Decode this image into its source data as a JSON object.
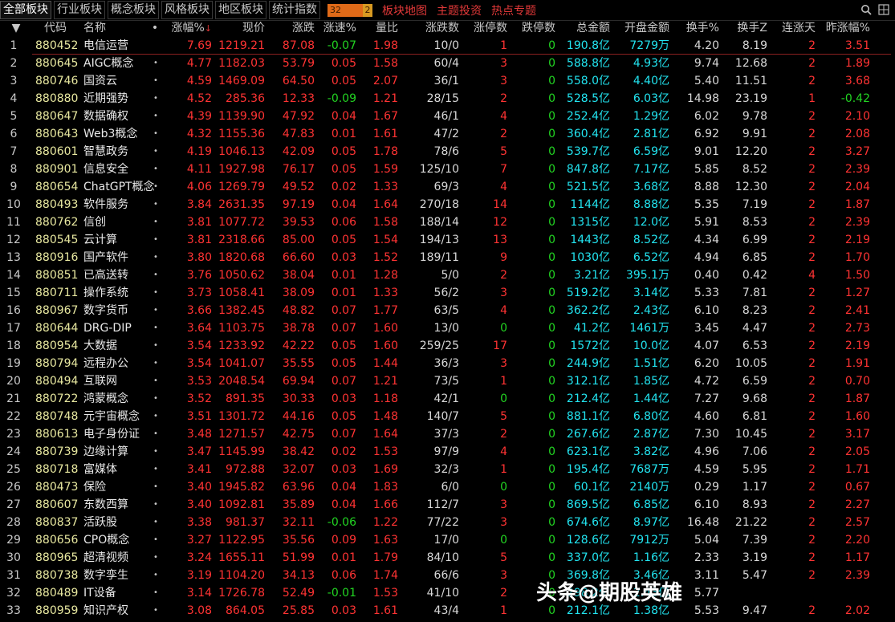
{
  "tabs": [
    {
      "label": "全部板块",
      "active": true
    },
    {
      "label": "行业板块"
    },
    {
      "label": "概念板块"
    },
    {
      "label": "风格板块"
    },
    {
      "label": "地区板块"
    },
    {
      "label": "统计指数"
    }
  ],
  "counter": {
    "value": "32",
    "flag": "2"
  },
  "links": [
    "板块地图",
    "主题投资",
    "热点专题"
  ],
  "icons": [
    "search-icon",
    "grid-icon"
  ],
  "colors": {
    "up": "#ff3333",
    "down": "#22d422",
    "cyan": "#22e4f0",
    "code": "#e8e8a0",
    "accent": "#e03838"
  },
  "columns": {
    "sort": "▼",
    "code": "代码",
    "name": "名称",
    "dot": "•",
    "change_pct": "涨幅%",
    "sort_icon": "↓",
    "price": "现价",
    "change": "涨跌",
    "speed": "涨速%",
    "volume_ratio": "量比",
    "up_down": "涨跌数",
    "limit_up": "涨停数",
    "limit_down": "跌停数",
    "amount": "总金额",
    "open_amount": "开盘金额",
    "turnover": "换手%",
    "turnover_z": "换手Z",
    "consecutive": "连涨天",
    "prev_change": "昨涨幅%"
  },
  "rows": [
    {
      "idx": "1",
      "code": "880452",
      "name": "电信运营",
      "dot": "",
      "pct": "7.69",
      "price": "1219.21",
      "chg": "87.08",
      "spd": "-0.07",
      "vr": "1.98",
      "ud": "10/0",
      "lu": "1",
      "ld": "0",
      "amt": "190.8亿",
      "oamt": "7279万",
      "to": "4.20",
      "toz": "8.19",
      "cd": "2",
      "prev": "3.51"
    },
    {
      "idx": "2",
      "code": "880645",
      "name": "AIGC概念",
      "dot": "•",
      "pct": "4.77",
      "price": "1182.03",
      "chg": "53.79",
      "spd": "0.05",
      "vr": "1.58",
      "ud": "60/4",
      "lu": "3",
      "ld": "0",
      "amt": "588.8亿",
      "oamt": "4.93亿",
      "to": "9.74",
      "toz": "12.68",
      "cd": "2",
      "prev": "1.89"
    },
    {
      "idx": "3",
      "code": "880746",
      "name": "国资云",
      "dot": "•",
      "pct": "4.59",
      "price": "1469.09",
      "chg": "64.50",
      "spd": "0.05",
      "vr": "2.07",
      "ud": "36/1",
      "lu": "3",
      "ld": "0",
      "amt": "558.0亿",
      "oamt": "4.40亿",
      "to": "5.40",
      "toz": "11.51",
      "cd": "2",
      "prev": "3.68"
    },
    {
      "idx": "4",
      "code": "880880",
      "name": "近期强势",
      "dot": "•",
      "pct": "4.52",
      "price": "285.36",
      "chg": "12.33",
      "spd": "-0.09",
      "vr": "1.21",
      "ud": "28/15",
      "lu": "2",
      "ld": "0",
      "amt": "528.5亿",
      "oamt": "6.03亿",
      "to": "14.98",
      "toz": "23.19",
      "cd": "1",
      "prev": "-0.42"
    },
    {
      "idx": "5",
      "code": "880647",
      "name": "数据确权",
      "dot": "•",
      "pct": "4.39",
      "price": "1139.90",
      "chg": "47.92",
      "spd": "0.04",
      "vr": "1.67",
      "ud": "46/1",
      "lu": "4",
      "ld": "0",
      "amt": "252.4亿",
      "oamt": "1.29亿",
      "to": "6.02",
      "toz": "9.78",
      "cd": "2",
      "prev": "2.10"
    },
    {
      "idx": "6",
      "code": "880643",
      "name": "Web3概念",
      "dot": "•",
      "pct": "4.32",
      "price": "1155.36",
      "chg": "47.83",
      "spd": "0.01",
      "vr": "1.61",
      "ud": "47/2",
      "lu": "2",
      "ld": "0",
      "amt": "360.4亿",
      "oamt": "2.81亿",
      "to": "6.92",
      "toz": "9.91",
      "cd": "2",
      "prev": "2.08"
    },
    {
      "idx": "7",
      "code": "880601",
      "name": "智慧政务",
      "dot": "•",
      "pct": "4.19",
      "price": "1046.13",
      "chg": "42.09",
      "spd": "0.05",
      "vr": "1.78",
      "ud": "78/6",
      "lu": "5",
      "ld": "0",
      "amt": "539.7亿",
      "oamt": "6.59亿",
      "to": "9.01",
      "toz": "12.20",
      "cd": "2",
      "prev": "3.27"
    },
    {
      "idx": "8",
      "code": "880901",
      "name": "信息安全",
      "dot": "•",
      "pct": "4.11",
      "price": "1927.98",
      "chg": "76.17",
      "spd": "0.05",
      "vr": "1.59",
      "ud": "125/10",
      "lu": "7",
      "ld": "0",
      "amt": "847.8亿",
      "oamt": "7.17亿",
      "to": "5.85",
      "toz": "8.52",
      "cd": "2",
      "prev": "2.39"
    },
    {
      "idx": "9",
      "code": "880654",
      "name": "ChatGPT概念",
      "dot": "•",
      "pct": "4.06",
      "price": "1269.79",
      "chg": "49.52",
      "spd": "0.02",
      "vr": "1.33",
      "ud": "69/3",
      "lu": "4",
      "ld": "0",
      "amt": "521.5亿",
      "oamt": "3.68亿",
      "to": "8.88",
      "toz": "12.30",
      "cd": "2",
      "prev": "2.04"
    },
    {
      "idx": "10",
      "code": "880493",
      "name": "软件服务",
      "dot": "•",
      "pct": "3.84",
      "price": "2631.35",
      "chg": "97.19",
      "spd": "0.04",
      "vr": "1.64",
      "ud": "270/18",
      "lu": "14",
      "ld": "0",
      "amt": "1144亿",
      "oamt": "8.88亿",
      "to": "5.35",
      "toz": "7.19",
      "cd": "2",
      "prev": "1.87"
    },
    {
      "idx": "11",
      "code": "880762",
      "name": "信创",
      "dot": "•",
      "pct": "3.81",
      "price": "1077.72",
      "chg": "39.53",
      "spd": "0.06",
      "vr": "1.58",
      "ud": "188/14",
      "lu": "12",
      "ld": "0",
      "amt": "1315亿",
      "oamt": "12.0亿",
      "to": "5.91",
      "toz": "8.53",
      "cd": "2",
      "prev": "2.39"
    },
    {
      "idx": "12",
      "code": "880545",
      "name": "云计算",
      "dot": "•",
      "pct": "3.81",
      "price": "2318.66",
      "chg": "85.00",
      "spd": "0.05",
      "vr": "1.54",
      "ud": "194/13",
      "lu": "13",
      "ld": "0",
      "amt": "1443亿",
      "oamt": "8.52亿",
      "to": "4.34",
      "toz": "6.99",
      "cd": "2",
      "prev": "2.19"
    },
    {
      "idx": "13",
      "code": "880916",
      "name": "国产软件",
      "dot": "•",
      "pct": "3.80",
      "price": "1820.68",
      "chg": "66.60",
      "spd": "0.03",
      "vr": "1.52",
      "ud": "189/11",
      "lu": "9",
      "ld": "0",
      "amt": "1030亿",
      "oamt": "6.52亿",
      "to": "4.94",
      "toz": "6.85",
      "cd": "2",
      "prev": "1.70"
    },
    {
      "idx": "14",
      "code": "880851",
      "name": "已高送转",
      "dot": "•",
      "pct": "3.76",
      "price": "1050.62",
      "chg": "38.04",
      "spd": "0.01",
      "vr": "1.28",
      "ud": "5/0",
      "lu": "2",
      "ld": "0",
      "amt": "3.21亿",
      "oamt": "395.1万",
      "to": "0.40",
      "toz": "0.42",
      "cd": "4",
      "prev": "1.50"
    },
    {
      "idx": "15",
      "code": "880711",
      "name": "操作系统",
      "dot": "•",
      "pct": "3.73",
      "price": "1058.41",
      "chg": "38.09",
      "spd": "0.01",
      "vr": "1.33",
      "ud": "56/2",
      "lu": "3",
      "ld": "0",
      "amt": "519.2亿",
      "oamt": "3.14亿",
      "to": "5.33",
      "toz": "7.81",
      "cd": "2",
      "prev": "1.27"
    },
    {
      "idx": "16",
      "code": "880967",
      "name": "数字货币",
      "dot": "•",
      "pct": "3.66",
      "price": "1382.45",
      "chg": "48.82",
      "spd": "0.07",
      "vr": "1.77",
      "ud": "63/5",
      "lu": "4",
      "ld": "0",
      "amt": "362.2亿",
      "oamt": "2.43亿",
      "to": "6.10",
      "toz": "8.23",
      "cd": "2",
      "prev": "2.41"
    },
    {
      "idx": "17",
      "code": "880644",
      "name": "DRG-DIP",
      "dot": "•",
      "pct": "3.64",
      "price": "1103.75",
      "chg": "38.78",
      "spd": "0.07",
      "vr": "1.60",
      "ud": "13/0",
      "lu": "0",
      "ld": "0",
      "amt": "41.2亿",
      "oamt": "1461万",
      "to": "3.45",
      "toz": "4.47",
      "cd": "2",
      "prev": "2.73"
    },
    {
      "idx": "18",
      "code": "880954",
      "name": "大数据",
      "dot": "•",
      "pct": "3.54",
      "price": "1233.92",
      "chg": "42.22",
      "spd": "0.05",
      "vr": "1.60",
      "ud": "259/25",
      "lu": "17",
      "ld": "0",
      "amt": "1572亿",
      "oamt": "10.0亿",
      "to": "4.07",
      "toz": "6.53",
      "cd": "2",
      "prev": "2.19"
    },
    {
      "idx": "19",
      "code": "880794",
      "name": "远程办公",
      "dot": "•",
      "pct": "3.54",
      "price": "1041.07",
      "chg": "35.55",
      "spd": "0.05",
      "vr": "1.44",
      "ud": "36/3",
      "lu": "3",
      "ld": "0",
      "amt": "244.9亿",
      "oamt": "1.51亿",
      "to": "6.20",
      "toz": "10.05",
      "cd": "2",
      "prev": "1.91"
    },
    {
      "idx": "20",
      "code": "880494",
      "name": "互联网",
      "dot": "•",
      "pct": "3.53",
      "price": "2048.54",
      "chg": "69.94",
      "spd": "0.07",
      "vr": "1.21",
      "ud": "73/5",
      "lu": "1",
      "ld": "0",
      "amt": "312.1亿",
      "oamt": "1.85亿",
      "to": "4.72",
      "toz": "6.59",
      "cd": "2",
      "prev": "0.70"
    },
    {
      "idx": "21",
      "code": "880722",
      "name": "鸿蒙概念",
      "dot": "•",
      "pct": "3.52",
      "price": "891.35",
      "chg": "30.33",
      "spd": "0.03",
      "vr": "1.18",
      "ud": "42/1",
      "lu": "0",
      "ld": "0",
      "amt": "212.4亿",
      "oamt": "1.44亿",
      "to": "7.27",
      "toz": "9.68",
      "cd": "2",
      "prev": "1.87"
    },
    {
      "idx": "22",
      "code": "880748",
      "name": "元宇宙概念",
      "dot": "•",
      "pct": "3.51",
      "price": "1301.72",
      "chg": "44.16",
      "spd": "0.05",
      "vr": "1.48",
      "ud": "140/7",
      "lu": "5",
      "ld": "0",
      "amt": "881.1亿",
      "oamt": "6.80亿",
      "to": "4.60",
      "toz": "6.81",
      "cd": "2",
      "prev": "1.60"
    },
    {
      "idx": "23",
      "code": "880613",
      "name": "电子身份证",
      "dot": "•",
      "pct": "3.48",
      "price": "1271.57",
      "chg": "42.75",
      "spd": "0.07",
      "vr": "1.64",
      "ud": "37/3",
      "lu": "2",
      "ld": "0",
      "amt": "267.6亿",
      "oamt": "2.87亿",
      "to": "7.30",
      "toz": "10.45",
      "cd": "2",
      "prev": "3.17"
    },
    {
      "idx": "24",
      "code": "880739",
      "name": "边缘计算",
      "dot": "•",
      "pct": "3.47",
      "price": "1145.99",
      "chg": "38.42",
      "spd": "0.02",
      "vr": "1.53",
      "ud": "97/9",
      "lu": "4",
      "ld": "0",
      "amt": "623.1亿",
      "oamt": "3.82亿",
      "to": "4.96",
      "toz": "7.06",
      "cd": "2",
      "prev": "2.05"
    },
    {
      "idx": "25",
      "code": "880718",
      "name": "富媒体",
      "dot": "•",
      "pct": "3.41",
      "price": "972.88",
      "chg": "32.07",
      "spd": "0.03",
      "vr": "1.69",
      "ud": "32/3",
      "lu": "1",
      "ld": "0",
      "amt": "195.4亿",
      "oamt": "7687万",
      "to": "4.59",
      "toz": "5.95",
      "cd": "2",
      "prev": "1.71"
    },
    {
      "idx": "26",
      "code": "880473",
      "name": "保险",
      "dot": "•",
      "pct": "3.40",
      "price": "1945.82",
      "chg": "63.96",
      "spd": "0.04",
      "vr": "1.83",
      "ud": "6/0",
      "lu": "0",
      "ld": "0",
      "amt": "60.1亿",
      "oamt": "2140万",
      "to": "0.29",
      "toz": "1.17",
      "cd": "2",
      "prev": "0.67"
    },
    {
      "idx": "27",
      "code": "880607",
      "name": "东数西算",
      "dot": "•",
      "pct": "3.40",
      "price": "1092.81",
      "chg": "35.89",
      "spd": "0.04",
      "vr": "1.66",
      "ud": "112/7",
      "lu": "3",
      "ld": "0",
      "amt": "869.5亿",
      "oamt": "6.85亿",
      "to": "6.10",
      "toz": "8.93",
      "cd": "2",
      "prev": "2.27"
    },
    {
      "idx": "28",
      "code": "880837",
      "name": "活跃股",
      "dot": "•",
      "pct": "3.38",
      "price": "981.37",
      "chg": "32.11",
      "spd": "-0.06",
      "vr": "1.22",
      "ud": "77/22",
      "lu": "3",
      "ld": "0",
      "amt": "674.6亿",
      "oamt": "8.97亿",
      "to": "16.48",
      "toz": "21.22",
      "cd": "2",
      "prev": "2.57"
    },
    {
      "idx": "29",
      "code": "880656",
      "name": "CPO概念",
      "dot": "•",
      "pct": "3.27",
      "price": "1122.95",
      "chg": "35.56",
      "spd": "0.09",
      "vr": "1.63",
      "ud": "17/0",
      "lu": "0",
      "ld": "0",
      "amt": "128.6亿",
      "oamt": "7912万",
      "to": "5.04",
      "toz": "7.39",
      "cd": "2",
      "prev": "2.20"
    },
    {
      "idx": "30",
      "code": "880965",
      "name": "超清视频",
      "dot": "•",
      "pct": "3.24",
      "price": "1655.11",
      "chg": "51.99",
      "spd": "0.01",
      "vr": "1.79",
      "ud": "84/10",
      "lu": "5",
      "ld": "0",
      "amt": "337.0亿",
      "oamt": "1.16亿",
      "to": "2.33",
      "toz": "3.19",
      "cd": "2",
      "prev": "1.17"
    },
    {
      "idx": "31",
      "code": "880738",
      "name": "数字孪生",
      "dot": "•",
      "pct": "3.19",
      "price": "1104.20",
      "chg": "34.13",
      "spd": "0.06",
      "vr": "1.74",
      "ud": "66/6",
      "lu": "3",
      "ld": "0",
      "amt": "369.8亿",
      "oamt": "3.46亿",
      "to": "3.11",
      "toz": "5.47",
      "cd": "2",
      "prev": "2.39"
    },
    {
      "idx": "32",
      "code": "880489",
      "name": "IT设备",
      "dot": "•",
      "pct": "3.14",
      "price": "1726.78",
      "chg": "52.49",
      "spd": "-0.01",
      "vr": "1.53",
      "ud": "41/10",
      "lu": "2",
      "ld": "0",
      "amt": "298.2亿",
      "oamt": "2.43亿",
      "to": "5.77",
      "toz": "",
      "cd": "",
      "prev": ""
    },
    {
      "idx": "33",
      "code": "880959",
      "name": "知识产权",
      "dot": "•",
      "pct": "3.08",
      "price": "864.05",
      "chg": "25.85",
      "spd": "0.03",
      "vr": "1.61",
      "ud": "43/4",
      "lu": "1",
      "ld": "0",
      "amt": "212.1亿",
      "oamt": "1.38亿",
      "to": "5.53",
      "toz": "9.47",
      "cd": "2",
      "prev": "2.02"
    }
  ],
  "watermark": "头条@期股英雄"
}
